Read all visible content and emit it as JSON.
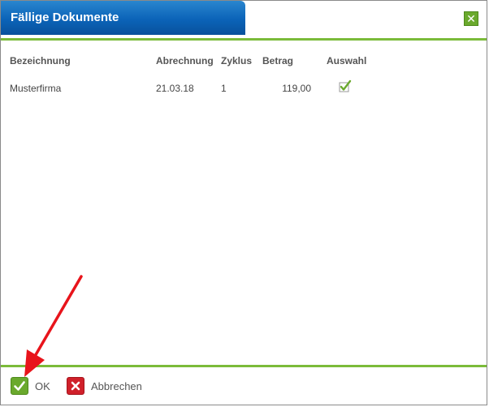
{
  "dialog": {
    "title": "Fällige Dokumente",
    "close_icon": "close-x-icon"
  },
  "table": {
    "headers": {
      "bezeichnung": "Bezeichnung",
      "abrechnung": "Abrechnung",
      "zyklus": "Zyklus",
      "betrag": "Betrag",
      "auswahl": "Auswahl"
    },
    "rows": [
      {
        "bezeichnung": "Musterfirma",
        "abrechnung": "21.03.18",
        "zyklus": "1",
        "betrag": "119,00",
        "auswahl_checked": true
      }
    ]
  },
  "footer": {
    "ok_label": "OK",
    "cancel_label": "Abbrechen"
  },
  "colors": {
    "title_blue": "#0b63b8",
    "accent_green": "#7bbb3a",
    "ok_green": "#6aa92d",
    "cancel_red": "#d0202a",
    "annotation_red": "#e8141b"
  }
}
